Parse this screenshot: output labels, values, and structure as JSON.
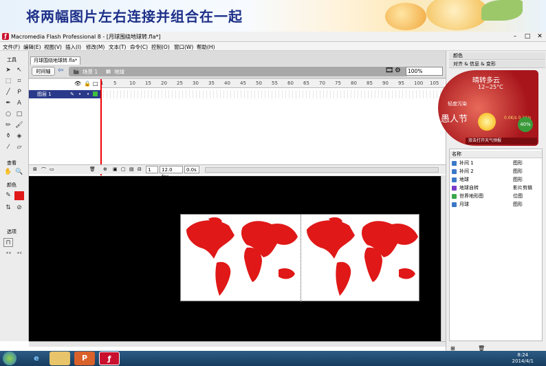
{
  "slide": {
    "title": "将两幅图片左右连接并组合在一起"
  },
  "window": {
    "title": "Macromedia Flash Professional 8 - [月球围绕地球转.fla*]",
    "minimize": "–",
    "restore": "□",
    "close": "✕"
  },
  "menu": [
    "文件(F)",
    "编辑(E)",
    "视图(V)",
    "插入(I)",
    "修改(M)",
    "文本(T)",
    "命令(C)",
    "控制(O)",
    "窗口(W)",
    "帮助(H)"
  ],
  "tools": {
    "header": "工具",
    "view_header": "查看",
    "color_header": "颜色",
    "options_header": "选项"
  },
  "document": {
    "tab": "月球围绕地球转.fla*",
    "timeline_button": "时间轴",
    "scene": "场景 1",
    "symbol": "地球",
    "zoom": "100%"
  },
  "timeline": {
    "ruler": [
      "1",
      "5",
      "10",
      "15",
      "20",
      "25",
      "30",
      "35",
      "40",
      "45",
      "50",
      "55",
      "60",
      "65",
      "70",
      "75",
      "80",
      "85",
      "90",
      "95",
      "100",
      "105"
    ],
    "layer_name": "图层 1",
    "frame": "1",
    "fps": "12.0 fps",
    "time": "0.0s"
  },
  "right_panel": {
    "color": "颜色",
    "align": "对齐 & 信息 & 变形",
    "library_header": "名称",
    "library_items": [
      {
        "name": "补间 1",
        "type": "图形"
      },
      {
        "name": "补间 2",
        "type": "图形"
      },
      {
        "name": "地球",
        "type": "图形"
      },
      {
        "name": "地球自转",
        "type": "影片剪辑"
      },
      {
        "name": "世界地形图",
        "type": "位图"
      },
      {
        "name": "月球",
        "type": "图形"
      }
    ]
  },
  "weather": {
    "condition": "晴转多云",
    "temp": "12~25°C",
    "holiday": "愚人节",
    "pct": "40%",
    "label_top": "轻度污染",
    "small": "0.0K/s\n0.1K/s",
    "bottom": "双击打开天气预报"
  },
  "taskbar": {
    "time": "8:24",
    "date": "2014/4/1"
  },
  "colors": {
    "title": "#1d2f88",
    "stage": "#000000",
    "map": "#e01818",
    "layer": "#2a3a8a",
    "playhead": "#ee0000"
  }
}
